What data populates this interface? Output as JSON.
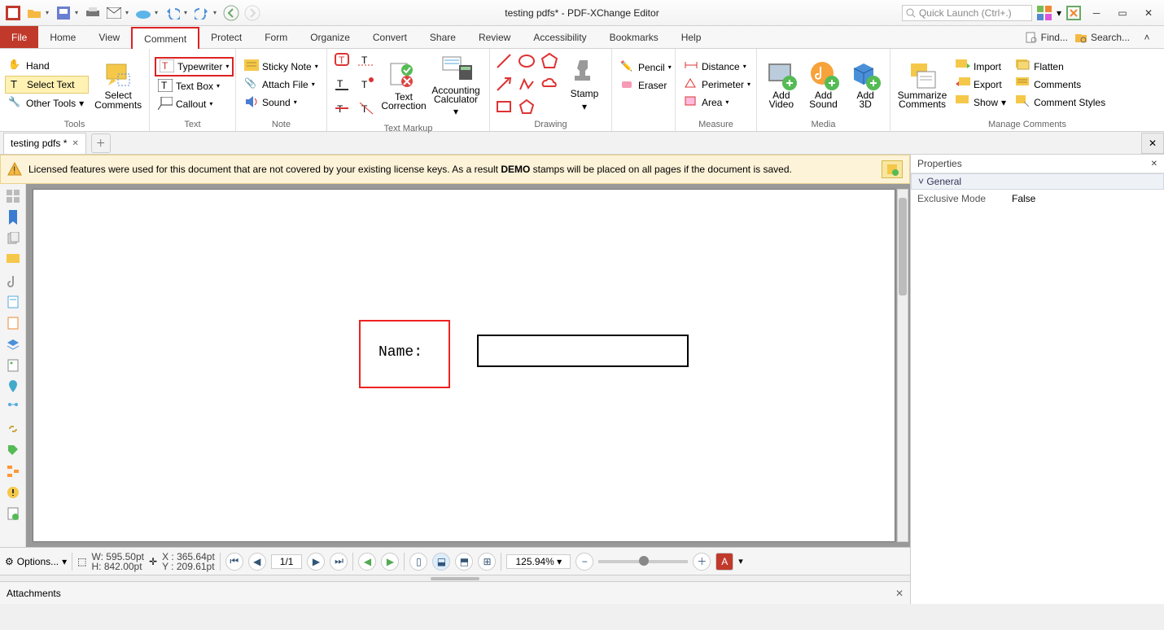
{
  "title": "testing pdfs* - PDF-XChange Editor",
  "quicklaunch_placeholder": "Quick Launch (Ctrl+.)",
  "menu": {
    "file": "File",
    "tabs": [
      "Home",
      "View",
      "Comment",
      "Protect",
      "Form",
      "Organize",
      "Convert",
      "Share",
      "Review",
      "Accessibility",
      "Bookmarks",
      "Help"
    ],
    "active_index": 2,
    "find": "Find...",
    "search": "Search..."
  },
  "ribbon": {
    "tools": {
      "label": "Tools",
      "hand": "Hand",
      "select_text": "Select Text",
      "other_tools": "Other Tools",
      "select_comments": "Select\nComments"
    },
    "text": {
      "label": "Text",
      "typewriter": "Typewriter",
      "text_box": "Text Box",
      "callout": "Callout"
    },
    "note": {
      "label": "Note",
      "sticky_note": "Sticky Note",
      "attach_file": "Attach File",
      "sound": "Sound"
    },
    "text_markup": {
      "label": "Text Markup",
      "text_correction": "Text\nCorrection",
      "accounting_calculator": "Accounting\nCalculator"
    },
    "drawing": {
      "label": "Drawing",
      "stamp": "Stamp"
    },
    "pencil_eraser": {
      "pencil": "Pencil",
      "eraser": "Eraser"
    },
    "measure": {
      "label": "Measure",
      "distance": "Distance",
      "perimeter": "Perimeter",
      "area": "Area"
    },
    "media": {
      "label": "Media",
      "add_video": "Add\nVideo",
      "add_sound": "Add\nSound",
      "add_3d": "Add\n3D"
    },
    "manage": {
      "label": "Manage Comments",
      "summarize": "Summarize\nComments",
      "import": "Import",
      "export": "Export",
      "show": "Show",
      "flatten": "Flatten",
      "comments": "Comments",
      "comment_styles": "Comment Styles"
    }
  },
  "doctab": {
    "name": "testing pdfs *"
  },
  "warning": {
    "pre": "Licensed features were used for this document that are not covered by your existing license keys. As a result ",
    "bold": "DEMO",
    "post": " stamps will be placed on all pages if the document is saved."
  },
  "page_content": {
    "name_label": "Name:"
  },
  "properties": {
    "title": "Properties",
    "group": "General",
    "exclusive_mode_key": "Exclusive Mode",
    "exclusive_mode_val": "False"
  },
  "navbar": {
    "options": "Options...",
    "W": "W: 595.50pt",
    "H": "H: 842.00pt",
    "X": "X : 365.64pt",
    "Y": "Y : 209.61pt",
    "page": "1/1",
    "zoom": "125.94%"
  },
  "attachments": {
    "title": "Attachments"
  }
}
